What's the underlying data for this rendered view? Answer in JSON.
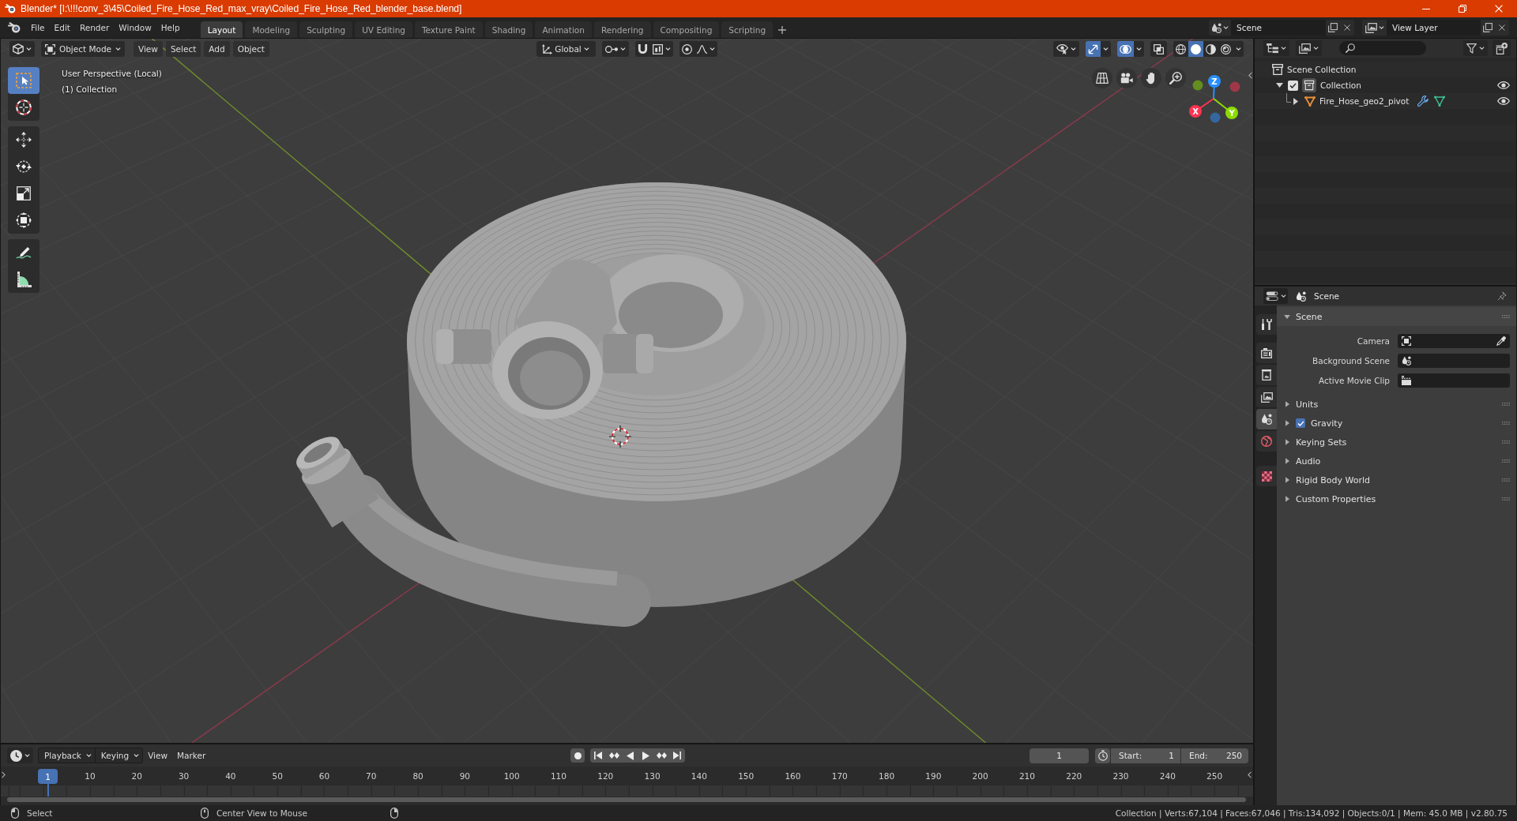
{
  "title_bar": {
    "title": "Blender* [I:\\!!!conv_3\\45\\Coiled_Fire_Hose_Red_max_vray\\Coiled_Fire_Hose_Red_blender_base.blend]"
  },
  "top_bar": {
    "menus": [
      "File",
      "Edit",
      "Render",
      "Window",
      "Help"
    ],
    "workspaces": [
      {
        "label": "Layout",
        "selected": true
      },
      {
        "label": "Modeling",
        "selected": false
      },
      {
        "label": "Sculpting",
        "selected": false
      },
      {
        "label": "UV Editing",
        "selected": false
      },
      {
        "label": "Texture Paint",
        "selected": false
      },
      {
        "label": "Shading",
        "selected": false
      },
      {
        "label": "Animation",
        "selected": false
      },
      {
        "label": "Rendering",
        "selected": false
      },
      {
        "label": "Compositing",
        "selected": false
      },
      {
        "label": "Scripting",
        "selected": false
      }
    ],
    "scene": "Scene",
    "view_layer": "View Layer"
  },
  "viewport": {
    "header": {
      "mode": "Object Mode",
      "menus": [
        "View",
        "Select",
        "Add",
        "Object"
      ],
      "orientation": "Global",
      "gizmos_on": true,
      "overlays_on": true,
      "xray": false,
      "shading": [
        {
          "kind": "wireframe",
          "selected": false
        },
        {
          "kind": "solid",
          "selected": true
        },
        {
          "kind": "material",
          "selected": false
        },
        {
          "kind": "rendered",
          "selected": false
        }
      ]
    },
    "tools": [
      {
        "kind": "select_box",
        "selected": true
      },
      {
        "kind": "cursor",
        "selected": false
      },
      {
        "kind": "move",
        "selected": false
      },
      {
        "kind": "rotate",
        "selected": false
      },
      {
        "kind": "scale",
        "selected": false
      },
      {
        "kind": "transform",
        "selected": false
      },
      {
        "kind": "annotate",
        "selected": false
      },
      {
        "kind": "measure",
        "selected": false
      }
    ],
    "view_name": "User Perspective (Local)",
    "collection_label": "(1) Collection",
    "gizmo": {
      "axes": [
        {
          "label": "X",
          "color": "#ff3352"
        },
        {
          "label": "Y",
          "color": "#8bdc00"
        },
        {
          "label": "Z",
          "color": "#2890ff"
        }
      ]
    }
  },
  "outliner": {
    "tree": [
      {
        "label": "Scene Collection",
        "kind": "scene_collection",
        "children": [
          {
            "label": "Collection",
            "kind": "collection",
            "expanded": true,
            "checked": true,
            "active": true,
            "visible": true,
            "children": [
              {
                "label": "Fire_Hose_geo2_pivot",
                "kind": "mesh",
                "expanded": false,
                "visible": true,
                "extras": [
                  {
                    "kind": "modifier"
                  },
                  {
                    "kind": "mesh_data"
                  }
                ]
              }
            ]
          }
        ]
      }
    ]
  },
  "properties": {
    "context": "Scene",
    "tabs": [
      {
        "kind": "tool",
        "selected": false
      },
      {
        "kind": "render",
        "selected": false
      },
      {
        "kind": "output",
        "selected": false
      },
      {
        "kind": "view_layer",
        "selected": false
      },
      {
        "kind": "scene",
        "selected": true
      },
      {
        "kind": "world",
        "selected": false
      },
      {
        "kind": "texture",
        "selected": false
      }
    ],
    "panels": [
      {
        "title": "Scene",
        "expanded": true,
        "fields": [
          {
            "label": "Camera",
            "kind": "camera"
          },
          {
            "label": "Background Scene",
            "kind": "scene"
          },
          {
            "label": "Active Movie Clip",
            "kind": "movie_clip"
          }
        ]
      },
      {
        "title": "Units",
        "expanded": false
      },
      {
        "title": "Gravity",
        "expanded": false,
        "checked": true
      },
      {
        "title": "Keying Sets",
        "expanded": false
      },
      {
        "title": "Audio",
        "expanded": false
      },
      {
        "title": "Rigid Body World",
        "expanded": false
      },
      {
        "title": "Custom Properties",
        "expanded": false
      }
    ]
  },
  "timeline": {
    "menus": [
      {
        "label": "Playback",
        "kind": "dropdown"
      },
      {
        "label": "Keying",
        "kind": "dropdown"
      },
      {
        "label": "View",
        "kind": "menu"
      },
      {
        "label": "Marker",
        "kind": "menu"
      }
    ],
    "current_frame": "1",
    "start": {
      "label": "Start:",
      "value": "1"
    },
    "end": {
      "label": "End:",
      "value": "250"
    },
    "playhead": "1",
    "ruler": [
      "10",
      "20",
      "30",
      "40",
      "50",
      "60",
      "70",
      "80",
      "90",
      "100",
      "110",
      "120",
      "130",
      "140",
      "150",
      "160",
      "170",
      "180",
      "190",
      "200",
      "210",
      "220",
      "230",
      "240",
      "250"
    ]
  },
  "status_bar": {
    "hints": [
      "Select",
      "Center View to Mouse"
    ],
    "stats": "Collection | Verts:67,104 | Faces:67,046 | Tris:134,092 | Objects:0/1 | Mem: 45.0 MB | v2.80.75"
  }
}
